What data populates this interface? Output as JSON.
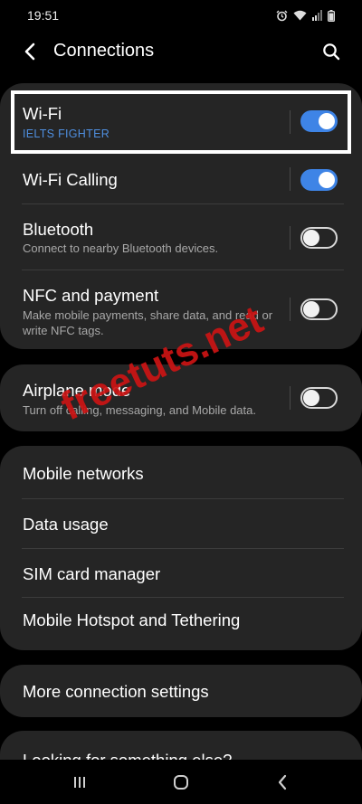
{
  "status_bar": {
    "time": "19:51",
    "icons": [
      "alarm-icon",
      "wifi-icon",
      "signal-icon",
      "battery-icon"
    ]
  },
  "header": {
    "title": "Connections",
    "back_icon": "chevron-left-icon",
    "search_icon": "search-icon"
  },
  "group1": {
    "wifi": {
      "title": "Wi-Fi",
      "subtitle": "IELTS FIGHTER",
      "enabled": true
    },
    "wifi_calling": {
      "title": "Wi-Fi Calling",
      "enabled": true
    },
    "bluetooth": {
      "title": "Bluetooth",
      "subtitle": "Connect to nearby Bluetooth devices.",
      "enabled": false
    },
    "nfc": {
      "title": "NFC and payment",
      "subtitle": "Make mobile payments, share data, and read or write NFC tags.",
      "enabled": false
    }
  },
  "group2": {
    "airplane": {
      "title": "Airplane mode",
      "subtitle": "Turn off calling, messaging, and Mobile data.",
      "enabled": false
    }
  },
  "group3": {
    "items": [
      "Mobile networks",
      "Data usage",
      "SIM card manager",
      "Mobile Hotspot and Tethering"
    ]
  },
  "group4": {
    "more": "More connection settings"
  },
  "group5": {
    "looking": "Looking for something else?"
  },
  "watermark": "freetuts.net",
  "colors": {
    "accent": "#3e84e6",
    "card": "#252525",
    "watermark": "#cc1414"
  },
  "nav": {
    "icons": [
      "recent-apps-icon",
      "home-icon",
      "back-icon"
    ]
  }
}
